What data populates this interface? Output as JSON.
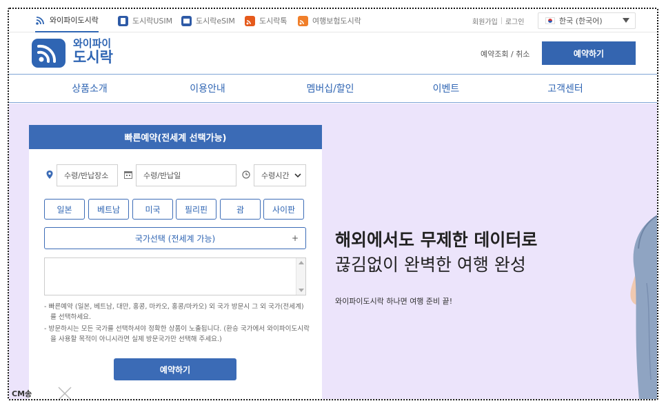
{
  "topbar": {
    "tabs": [
      {
        "label": "와이파이도시락",
        "icon": "wifi-icon",
        "active": true
      },
      {
        "label": "도시락USIM",
        "icon": "usim-icon"
      },
      {
        "label": "도시락eSIM",
        "icon": "esim-icon"
      },
      {
        "label": "도시락톡",
        "icon": "talk-icon"
      },
      {
        "label": "여행보험도시락",
        "icon": "insurance-icon"
      }
    ],
    "signup": "회원가입",
    "login": "로그인",
    "language": "한국 (한국어)"
  },
  "header": {
    "logo_line1": "와이파이",
    "logo_line2": "도시락",
    "lookup": "예약조회 / 취소",
    "reserve": "예약하기"
  },
  "nav": [
    "상품소개",
    "이용안내",
    "멤버십/할인",
    "이벤트",
    "고객센터"
  ],
  "booking": {
    "title": "빠른예약(전세계 선택가능)",
    "place_placeholder": "수령/반납장소",
    "date_placeholder": "수령/반납일",
    "time_placeholder": "수령시간",
    "countries": [
      "일본",
      "베트남",
      "미국",
      "필리핀",
      "괌",
      "사이판"
    ],
    "country_select": "국가선택 (전세계 가능)",
    "country_select_plus": "+",
    "notes": [
      "- 빠른예약 (일본, 베트남, 대만, 홍콩, 마카오, 홍콩/마카오) 외 국가 방문시 그 외 국가(전세계)를 선택하세요.",
      "- 방문하시는 모든 국가를 선택하셔야 정확한 상품이 노출됩니다. (환승 국가에서 와이파이도시락을 사용할 목적이 아니시라면 실제 방문국가만 선택해 주세요.)"
    ],
    "submit": "예약하기"
  },
  "hero": {
    "title_line1": "해외에서도 무제한 데이터로",
    "title_line2": "끊김없이 완벽한 여행 완성",
    "subtitle": "와이파이도시락 하나면 여행 준비 끝!"
  },
  "overlay": {
    "label": "CM송"
  },
  "colors": {
    "brand": "#2f65b3",
    "hero_bg": "#ece4fb",
    "button": "#3b6bb6"
  }
}
